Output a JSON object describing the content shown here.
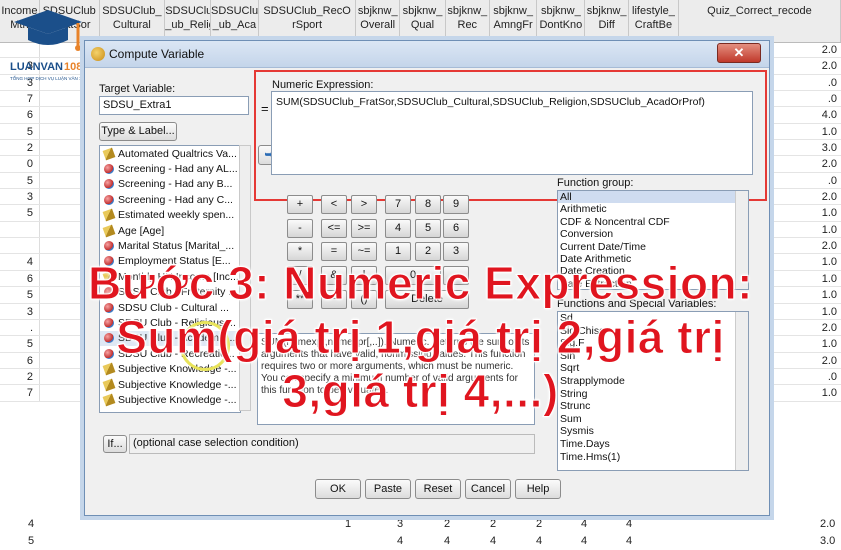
{
  "sheet": {
    "columns": [
      {
        "label": "Income\nMth",
        "w": 40
      },
      {
        "label": "SDSUClub\n_FratSor",
        "w": 60
      },
      {
        "label": "SDSUClub_\nCultural",
        "w": 66
      },
      {
        "label": "SDSUClub\n_ub_Relig",
        "w": 46
      },
      {
        "label": "SDSUClub\n_ub_Aca",
        "w": 48
      },
      {
        "label": "SDSUClub_RecO\nrSport",
        "w": 98
      },
      {
        "label": "sbjknw_\nOverall",
        "w": 44
      },
      {
        "label": "sbjknw_\nQual",
        "w": 46
      },
      {
        "label": "sbjknw_\nRec",
        "w": 44
      },
      {
        "label": "sbjknw_\nAmngFr",
        "w": 48
      },
      {
        "label": "sbjknw_\nDontKno",
        "w": 48
      },
      {
        "label": "sbjknw_\nDiff",
        "w": 44
      },
      {
        "label": "lifestyle_\nCraftBe",
        "w": 50
      },
      {
        "label": "Quiz_Correct_recode",
        "w": 163
      }
    ],
    "left_values": [
      "",
      "3",
      "3",
      "7",
      "6",
      "5",
      "2",
      "0",
      "5",
      "3",
      "5",
      "",
      "",
      "4",
      "6",
      "5",
      "3",
      ".",
      "5",
      "6",
      "2",
      "7"
    ],
    "right_values": [
      "2.0",
      "2.0",
      ".0",
      ".0",
      "4.0",
      "1.0",
      "3.0",
      "2.0",
      ".0",
      "2.0",
      "1.0",
      "1.0",
      "2.0",
      "1.0",
      "1.0",
      "1.0",
      "1.0",
      "2.0",
      "1.0",
      "2.0",
      ".0",
      "1.0"
    ],
    "bottom_rows": [
      {
        "left": "4",
        "vals": [
          "1",
          "3",
          "2",
          "2",
          "2",
          "4",
          "4"
        ],
        "right": "2.0"
      },
      {
        "left": "5",
        "vals": [
          "",
          "4",
          "4",
          "4",
          "4",
          "4",
          "4"
        ],
        "right": "3.0"
      }
    ]
  },
  "logo": {
    "name": "LUANVAN1080",
    "tagline": "TỔNG HỢP DỊCH VỤ LUẬN VĂN 1080"
  },
  "dialog": {
    "title": "Compute Variable",
    "close_label": "✕",
    "target_label": "Target Variable:",
    "target_value": "SDSU_Extra1",
    "equals": "=",
    "type_label_button": "Type & Label...",
    "numeric_expr_label": "Numeric Expression:",
    "numeric_expr_value": "SUM(SDSUClub_FratSor,SDSUClub_Cultural,SDSUClub_Religion,SDSUClub_AcadOrProf)",
    "move_arrow": "➥",
    "variables": [
      {
        "label": "Automated Qualtrics Va...",
        "icon": "ruler"
      },
      {
        "label": "Screening - Had any AL...",
        "icon": "ball"
      },
      {
        "label": "Screening - Had any B...",
        "icon": "ball"
      },
      {
        "label": "Screening - Had any C...",
        "icon": "ball"
      },
      {
        "label": "Estimated weekly spen...",
        "icon": "ruler"
      },
      {
        "label": "Age [Age]",
        "icon": "ruler"
      },
      {
        "label": "Marital Status [Marital_...",
        "icon": "ball"
      },
      {
        "label": "Employment Status [E...",
        "icon": "ball"
      },
      {
        "label": "Monthly HH Income [Inc...",
        "icon": "ruler"
      },
      {
        "label": "SDSU Club - Fraternity ...",
        "icon": "ball"
      },
      {
        "label": "SDSU Club - Cultural ...",
        "icon": "ball"
      },
      {
        "label": "SDSU Club - Religious ...",
        "icon": "ball"
      },
      {
        "label": "SDSU Club - Academic ...",
        "icon": "ball"
      },
      {
        "label": "SDSU Club - Recreatio...",
        "icon": "ball"
      },
      {
        "label": "Subjective Knowledge -...",
        "icon": "ruler"
      },
      {
        "label": "Subjective Knowledge -...",
        "icon": "ruler"
      },
      {
        "label": "Subjective Knowledge -...",
        "icon": "ruler"
      }
    ],
    "calc_rows": [
      [
        "+",
        "<",
        ">",
        "7",
        "8",
        "9"
      ],
      [
        "-",
        "<=",
        ">=",
        "4",
        "5",
        "6"
      ],
      [
        "*",
        "=",
        "~=",
        "1",
        "2",
        "3"
      ],
      [
        "/",
        "&",
        "|",
        "0",
        "."
      ],
      [
        "**",
        "~",
        "()",
        "Delete"
      ]
    ],
    "function_group_label": "Function group:",
    "function_groups": [
      "All",
      "Arithmetic",
      "CDF & Noncentral CDF",
      "Conversion",
      "Current Date/Time",
      "Date Arithmetic",
      "Date Creation",
      "Date Extraction"
    ],
    "functions_label": "Functions and Special Variables:",
    "functions": [
      "Sd",
      "Sig.Chisq",
      "Sig.F",
      "Sin",
      "Sqrt",
      "Strapplymode",
      "String",
      "Strunc",
      "Sum",
      "Sysmis",
      "Time.Days",
      "Time.Hms(1)"
    ],
    "description": "SUM(numexpr,numexpr[,..]). Numeric. Returns the sum of its arguments that have valid, nonmissing values. This function requires two or more arguments, which must be numeric. You can specify a minimum number of valid arguments for this function to be evaluated.",
    "if_button": "If...",
    "if_text": "(optional case selection condition)",
    "buttons": [
      "OK",
      "Paste",
      "Reset",
      "Cancel",
      "Help"
    ]
  },
  "caption": {
    "line1": "Bước 3: Numeric Expression:",
    "line2": "Sum(giá trị 1,giá trị 2,giá trị",
    "line3": "3,giá trị 4,...)"
  },
  "colors": {
    "caption": "#e0151f",
    "highlight_box": "#e53935",
    "dialog_border": "#6f8fb5"
  }
}
